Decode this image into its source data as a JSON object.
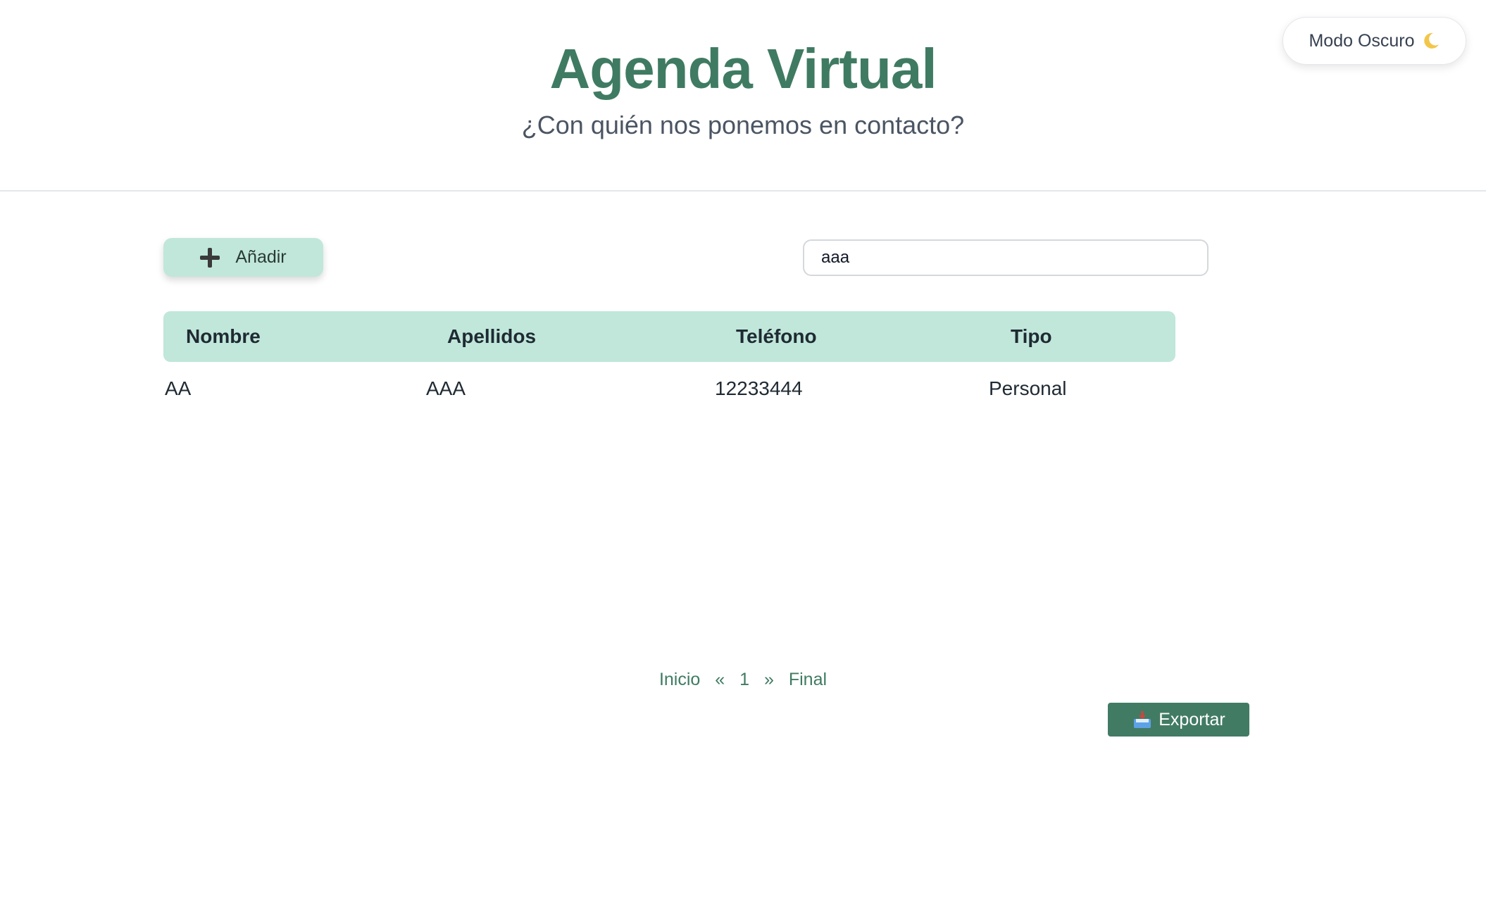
{
  "header": {
    "title": "Agenda Virtual",
    "subtitle": "¿Con quién nos ponemos en contacto?",
    "dark_mode_label": "Modo Oscuro",
    "dark_mode_icon": "moon-icon"
  },
  "toolbar": {
    "add_label": "Añadir",
    "add_icon": "plus-icon",
    "search_value": "aaa"
  },
  "table": {
    "columns": [
      "Nombre",
      "Apellidos",
      "Teléfono",
      "Tipo"
    ],
    "rows": [
      [
        "AA",
        "AAA",
        "12233444",
        "Personal"
      ]
    ]
  },
  "pagination": {
    "first": "Inicio",
    "prev": "«",
    "current": "1",
    "next": "»",
    "last": "Final"
  },
  "export": {
    "label": "Exportar",
    "icon": "inbox-tray-icon"
  },
  "colors": {
    "accent": "#3f7b62",
    "header_bg": "#c0e7da",
    "export_bg": "#427b64"
  }
}
